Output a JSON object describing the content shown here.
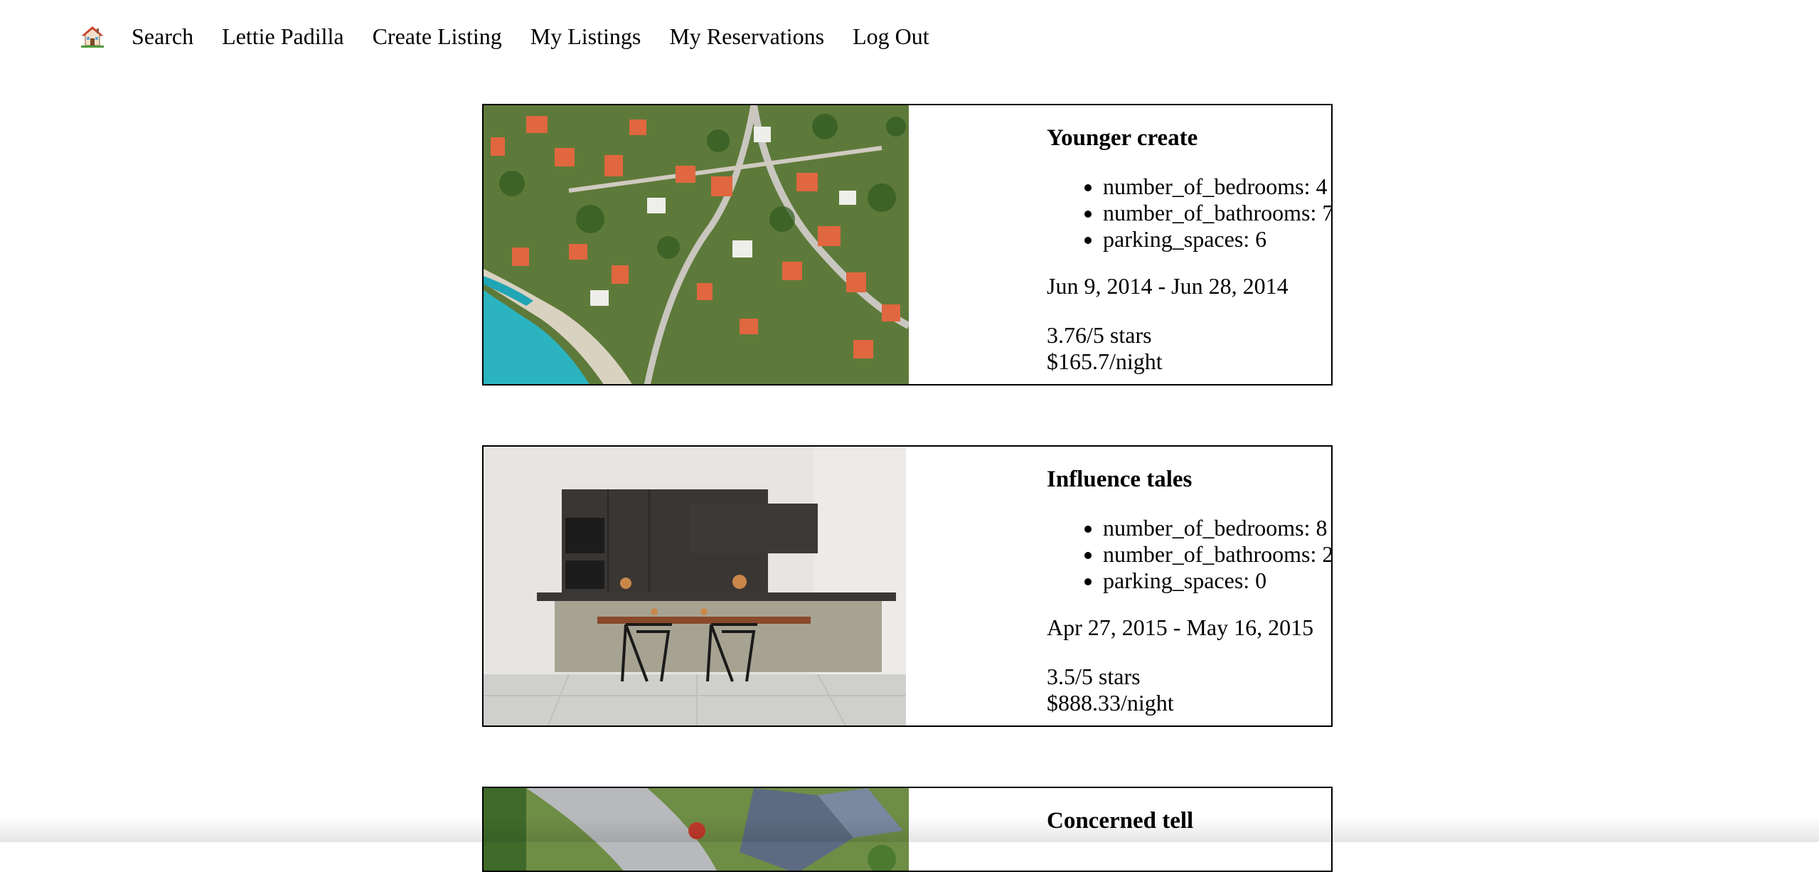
{
  "nav": {
    "home_icon": "house-emoji-icon",
    "items": [
      "Search",
      "Lettie Padilla",
      "Create Listing",
      "My Listings",
      "My Reservations",
      "Log Out"
    ]
  },
  "listings": [
    {
      "title": "Younger create",
      "image": "aerial-coastal-village-photo",
      "features": [
        "number_of_bedrooms: 4",
        "number_of_bathrooms: 7",
        "parking_spaces: 6"
      ],
      "dates": "Jun 9, 2014 - Jun 28, 2014",
      "rating": "3.76/5 stars",
      "price": "$165.7/night"
    },
    {
      "title": "Influence tales",
      "image": "modern-kitchen-island-photo",
      "features": [
        "number_of_bedrooms: 8",
        "number_of_bathrooms: 2",
        "parking_spaces: 0"
      ],
      "dates": "Apr 27, 2015 - May 16, 2015",
      "rating": "3.5/5 stars",
      "price": "$888.33/night"
    },
    {
      "title": "Concerned tell",
      "image": "aerial-suburban-house-photo"
    }
  ]
}
